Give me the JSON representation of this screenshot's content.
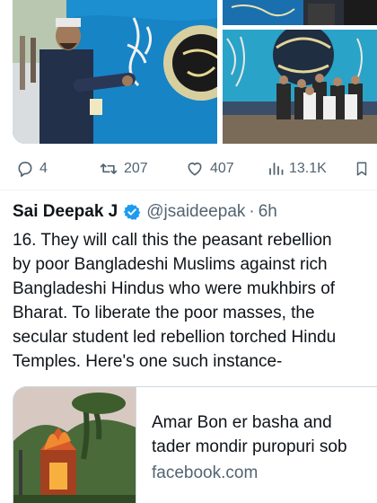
{
  "media": {
    "photo_1": "Man painting Arabic calligraphy on blue mural wall",
    "photo_3": "Group of people sitting in front of painted calligraphy mural"
  },
  "actions": {
    "replies": "4",
    "retweets": "207",
    "likes": "407",
    "views": "13.1K"
  },
  "tweet": {
    "author_name": "Sai Deepak J",
    "handle": "@jsaideepak",
    "separator": "·",
    "time": "6h",
    "lines": [
      "16. They will call this the peasant rebellion",
      "by poor Bangladeshi Muslims against rich",
      "Bangladeshi Hindus who were mukhbirs of",
      "Bharat. To liberate the poor masses, the",
      "secular student led rebellion torched Hindu",
      "Temples. Here's one such instance-"
    ]
  },
  "link_card": {
    "title_lines": [
      "Amar Bon er basha and",
      "tader mondir puropuri sob"
    ],
    "domain": "facebook.com"
  },
  "colors": {
    "verified": "#1d9bf0",
    "secondary_text": "#536471",
    "mural_blue": "#1c8fd0"
  }
}
